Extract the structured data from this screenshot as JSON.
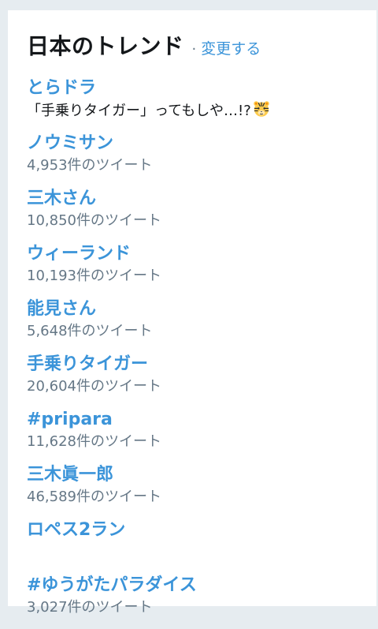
{
  "header": {
    "title": "日本のトレンド",
    "separator": "·",
    "change_link": "変更する"
  },
  "trends": [
    {
      "name": "とらドラ",
      "meta": "「手乗りタイガー」ってもしや…!?",
      "meta_icon": "tiger-face-icon"
    },
    {
      "name": "ノウミサン",
      "meta": "4,953件のツイート"
    },
    {
      "name": "三木さん",
      "meta": "10,850件のツイート"
    },
    {
      "name": "ウィーランド",
      "meta": "10,193件のツイート"
    },
    {
      "name": "能見さん",
      "meta": "5,648件のツイート"
    },
    {
      "name": "手乗りタイガー",
      "meta": "20,604件のツイート"
    },
    {
      "name": "#pripara",
      "meta": "11,628件のツイート"
    },
    {
      "name": "三木眞一郎",
      "meta": "46,589件のツイート"
    },
    {
      "name": "ロペス2ラン",
      "meta": ""
    },
    {
      "name": "#ゆうがたパラダイス",
      "meta": "3,027件のツイート"
    }
  ],
  "colors": {
    "link": "#3b94d9",
    "meta": "#657786",
    "title": "#14171a",
    "background": "#e6ecf0",
    "card": "#ffffff"
  }
}
